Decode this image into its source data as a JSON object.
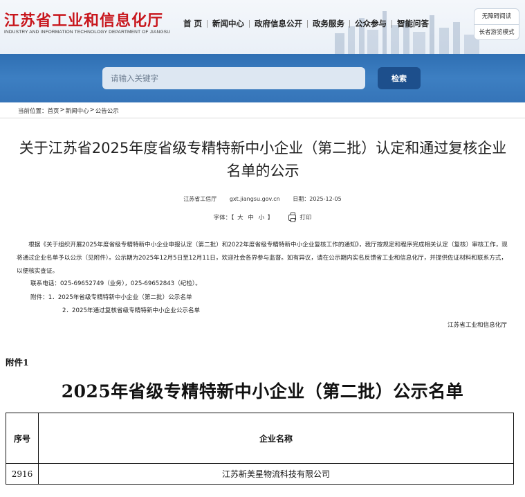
{
  "header": {
    "site_title": "江苏省工业和信息化厅",
    "site_subtitle": "INDUSTRY AND INFORMATION TECHNOLOGY DEPARTMENT OF JIANGSU",
    "nav": [
      "首 页",
      "新闻中心",
      "政府信息公开",
      "政务服务",
      "公众参与",
      "智能问答"
    ],
    "accessibility": [
      "无障碍阅读",
      "长者游览模式"
    ]
  },
  "search": {
    "placeholder": "请输入关键字",
    "button_label": "检索"
  },
  "breadcrumb": {
    "prefix": "当前位置：",
    "items": [
      "首页",
      "新闻中心",
      "公告公示"
    ],
    "separator": ">"
  },
  "article": {
    "title": "关于江苏省2025年度省级专精特新中小企业（第二批）认定和通过复核企业名单的公示",
    "source": "江苏省工信厅",
    "url": "gxt.jiangsu.gov.cn",
    "date_label": "日期：",
    "date": "2025-12-05",
    "font_size_label": "字体：【",
    "font_sizes": [
      "大",
      "中",
      "小"
    ],
    "font_size_close": "】",
    "print_label": "打印",
    "body": "根据《关于组织开展2025年度省级专精特新中小企业申报认定（第二批）和2022年度省级专精特新中小企业复核工作的通知》，我厅按规定和程序完成相关认定（复核）审核工作，现将通过企业名单予以公示（见附件）。公示期为2025年12月5日至12月11日，欢迎社会各界参与监督。如有异议，请在公示期内实名反馈省工业和信息化厅，并提供佐证材料和联系方式，以便核实查证。",
    "contact": "联系电话：025-69652749（业务），025-69652843（纪检）。",
    "attachment_1": "附件：1．2025年省级专精特新中小企业（第二批）公示名单",
    "attachment_2": "2．2025年通过复核省级专精特新中小企业公示名单",
    "signature": "江苏省工业和信息化厅"
  },
  "attachment_doc": {
    "label": "附件1",
    "title": "2025年省级专精特新中小企业（第二批）公示名单",
    "columns": [
      "序号",
      "企业名称"
    ],
    "rows": [
      [
        "2916",
        "江苏新美星物流科技有限公司"
      ]
    ]
  },
  "colors": {
    "brand_red": "#c8161d",
    "band_blue": "#3574b8",
    "button_blue": "#1d4f8c"
  }
}
